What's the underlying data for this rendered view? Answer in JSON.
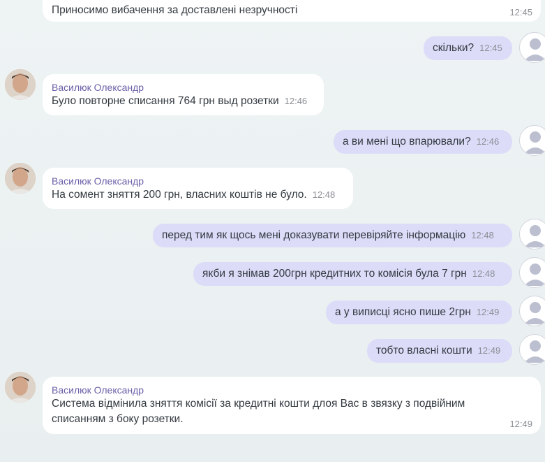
{
  "chat": {
    "messages": [
      {
        "dir": "in",
        "sender": "",
        "text": "Приносимо вибачення за доставлені незручності",
        "time": "12:45"
      },
      {
        "dir": "out",
        "text": "скільки?",
        "time": "12:45"
      },
      {
        "dir": "in",
        "sender": "Василюк Олександр",
        "text": "Було повторне списання 764 грн выд розетки",
        "time": "12:46"
      },
      {
        "dir": "out",
        "text": "а ви мені що впарювали?",
        "time": "12:46"
      },
      {
        "dir": "in",
        "sender": "Василюк Олександр",
        "text": "На сомент зняття 200 грн, власних коштів не було.",
        "time": "12:48"
      },
      {
        "dir": "out",
        "text": "перед тим як щось мені доказувати перевіряйте інформацію",
        "time": "12:48"
      },
      {
        "dir": "out",
        "text": "якби я знімав 200грн кредитних то комісія була 7 грн",
        "time": "12:48"
      },
      {
        "dir": "out",
        "text": "а у виписці ясно пише 2грн",
        "time": "12:49"
      },
      {
        "dir": "out",
        "text": "тобто власні кошти",
        "time": "12:49"
      },
      {
        "dir": "in",
        "sender": "Василюк Олександр",
        "text_line1": "Система відмінила зняття комісії за кредитні кошти длоя Вас в звязку з подвійним",
        "text_line2": "списанням з боку розетки.",
        "time": "12:49"
      }
    ]
  },
  "avatars": {
    "agent": "agent-photo-icon",
    "user": "default-user-icon"
  }
}
